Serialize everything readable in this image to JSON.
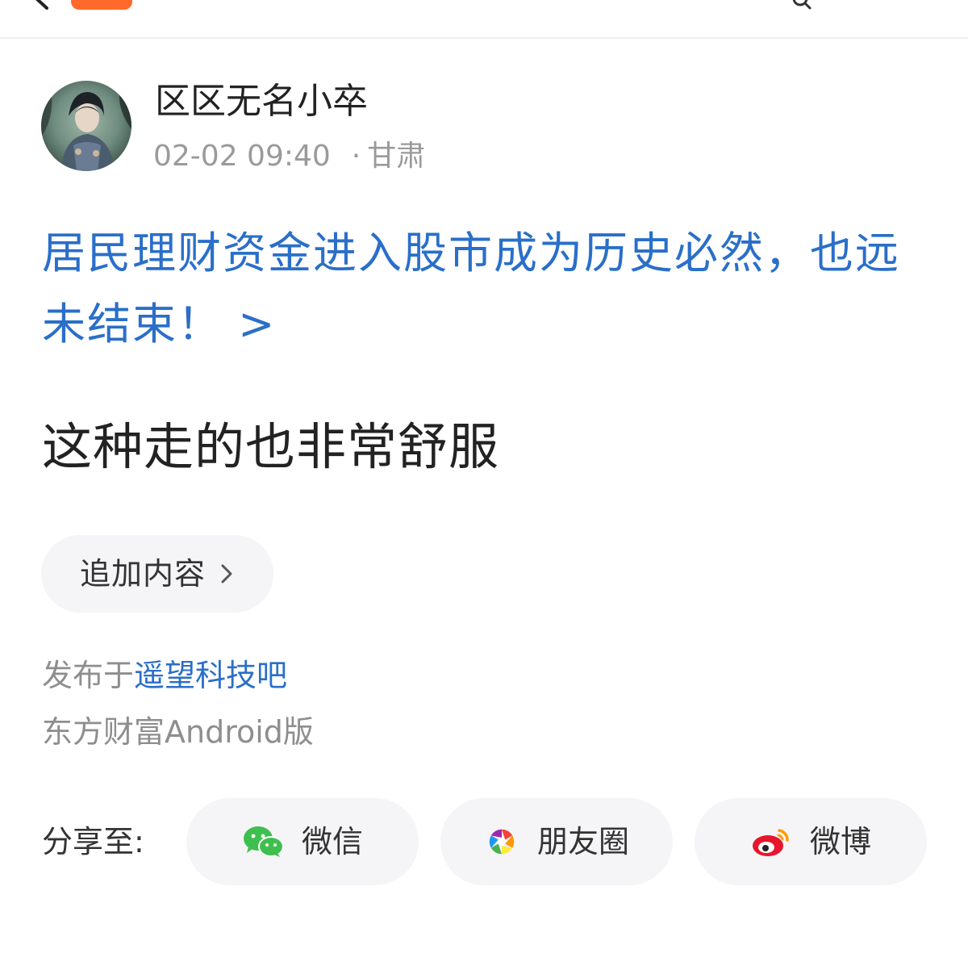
{
  "author": {
    "name": "区区无名小卒",
    "time": "02-02 09:40",
    "location_sep": "·",
    "location": "甘肃"
  },
  "post": {
    "title_link": "居民理财资金进入股市成为历史必然，也远未结束！ >",
    "body": "这种走的也非常舒服"
  },
  "append_button": {
    "label": "追加内容"
  },
  "source": {
    "posted_in_prefix": "发布于",
    "board_name": "遥望科技吧",
    "client": "东方财富Android版"
  },
  "share": {
    "label": "分享至:",
    "options": [
      {
        "label": "微信",
        "icon": "wechat-icon"
      },
      {
        "label": "朋友圈",
        "icon": "moments-icon"
      },
      {
        "label": "微博",
        "icon": "weibo-icon"
      }
    ]
  },
  "colors": {
    "link_blue": "#2a6fc9",
    "badge_orange": "#ff6a2b",
    "pill_bg": "#f5f5f7",
    "meta_gray": "#9a9a9a"
  }
}
